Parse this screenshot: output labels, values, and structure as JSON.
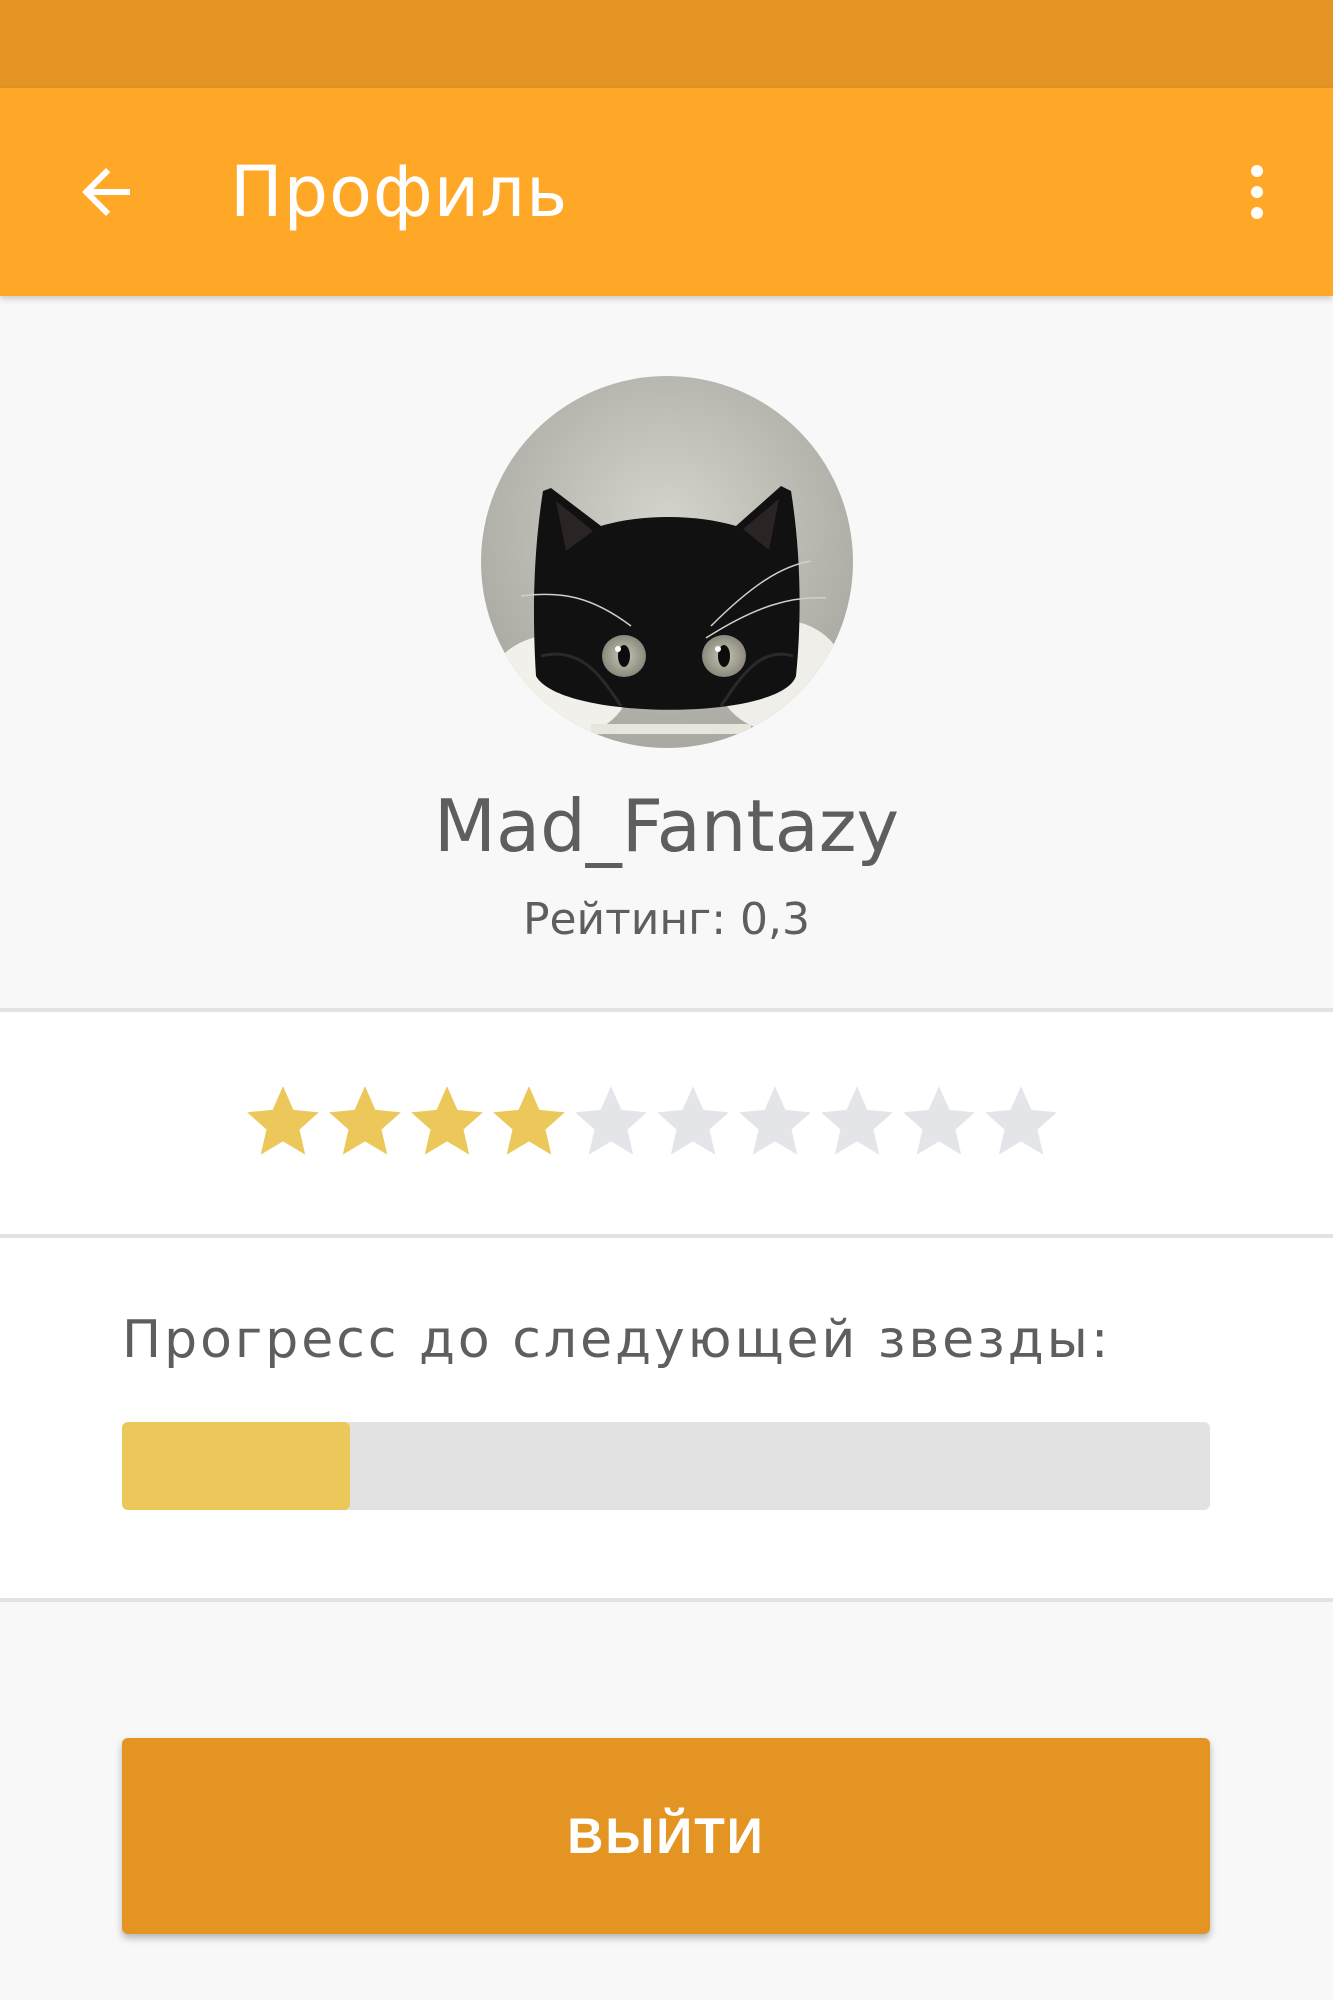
{
  "status_bar": {
    "color": "#e39423"
  },
  "app_bar": {
    "title": "Профиль",
    "color": "#ffa726",
    "back_icon": "arrow-left-icon",
    "menu_icon": "more-vert-icon"
  },
  "profile": {
    "avatar": "black-cat-photo",
    "username": "Mad_Fantazy",
    "rating_text": "Рейтинг: 0,3"
  },
  "stars": {
    "total": 10,
    "filled": 4,
    "filled_color": "#ecc75a",
    "empty_color": "#e4e5e8"
  },
  "progress": {
    "label": "Прогресс до следующей звезды:",
    "fraction": 0.21,
    "fill_color": "#ecc75a",
    "track_color": "#e2e2e2"
  },
  "logout": {
    "label": "ВЫЙТИ",
    "color": "#e39423"
  }
}
